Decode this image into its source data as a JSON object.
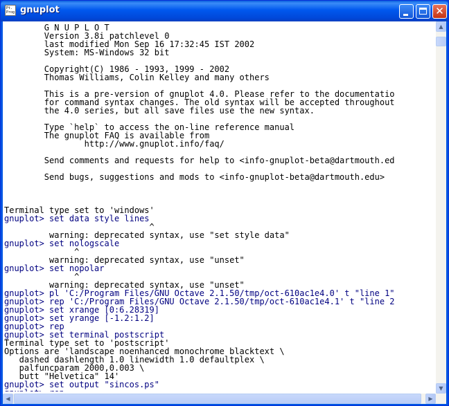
{
  "window": {
    "title": "gnuplot",
    "app_icon_text": "Pt. Prog",
    "minimize_icon": "minimize-icon",
    "maximize_icon": "maximize-icon",
    "close_icon": "close-icon"
  },
  "console": {
    "lines": [
      {
        "text": "        G N U P L O T",
        "type": "out"
      },
      {
        "text": "        Version 3.8i patchlevel 0",
        "type": "out"
      },
      {
        "text": "        last modified Mon Sep 16 17:32:45 IST 2002",
        "type": "out"
      },
      {
        "text": "        System: MS-Windows 32 bit",
        "type": "out"
      },
      {
        "text": "",
        "type": "out"
      },
      {
        "text": "        Copyright(C) 1986 - 1993, 1999 - 2002",
        "type": "out"
      },
      {
        "text": "        Thomas Williams, Colin Kelley and many others",
        "type": "out"
      },
      {
        "text": "",
        "type": "out"
      },
      {
        "text": "        This is a pre-version of gnuplot 4.0. Please refer to the documentatio",
        "type": "out"
      },
      {
        "text": "        for command syntax changes. The old syntax will be accepted throughout",
        "type": "out"
      },
      {
        "text": "        the 4.0 series, but all save files use the new syntax.",
        "type": "out"
      },
      {
        "text": "",
        "type": "out"
      },
      {
        "text": "        Type `help` to access the on-line reference manual",
        "type": "out"
      },
      {
        "text": "        The gnuplot FAQ is available from",
        "type": "out"
      },
      {
        "text": "                http://www.gnuplot.info/faq/",
        "type": "out"
      },
      {
        "text": "",
        "type": "out"
      },
      {
        "text": "        Send comments and requests for help to <info-gnuplot-beta@dartmouth.ed",
        "type": "out"
      },
      {
        "text": "",
        "type": "out"
      },
      {
        "text": "        Send bugs, suggestions and mods to <info-gnuplot-beta@dartmouth.edu>",
        "type": "out"
      },
      {
        "text": "",
        "type": "out"
      },
      {
        "text": "",
        "type": "out"
      },
      {
        "text": "",
        "type": "out"
      },
      {
        "text": "Terminal type set to 'windows'",
        "type": "out"
      },
      {
        "text": "gnuplot> set data style lines",
        "type": "cmd"
      },
      {
        "text": "                             ^",
        "type": "out"
      },
      {
        "text": "         warning: deprecated syntax, use \"set style data\"",
        "type": "out"
      },
      {
        "text": "gnuplot> set nologscale",
        "type": "cmd"
      },
      {
        "text": "              ^",
        "type": "out"
      },
      {
        "text": "         warning: deprecated syntax, use \"unset\"",
        "type": "out"
      },
      {
        "text": "gnuplot> set nopolar",
        "type": "cmd"
      },
      {
        "text": "              ^",
        "type": "out"
      },
      {
        "text": "         warning: deprecated syntax, use \"unset\"",
        "type": "out"
      },
      {
        "text": "gnuplot> pl 'C:/Program Files/GNU Octave 2.1.50/tmp/oct-610ac1e4.0' t \"line 1\"",
        "type": "cmd"
      },
      {
        "text": "gnuplot> rep 'C:/Program Files/GNU Octave 2.1.50/tmp/oct-610ac1e4.1' t \"line 2",
        "type": "cmd"
      },
      {
        "text": "gnuplot> set xrange [0:6.28319]",
        "type": "cmd"
      },
      {
        "text": "gnuplot> set yrange [-1.2:1.2]",
        "type": "cmd"
      },
      {
        "text": "gnuplot> rep",
        "type": "cmd"
      },
      {
        "text": "gnuplot> set terminal postscript",
        "type": "cmd"
      },
      {
        "text": "Terminal type set to 'postscript'",
        "type": "out"
      },
      {
        "text": "Options are 'landscape noenhanced monochrome blacktext \\",
        "type": "out"
      },
      {
        "text": "   dashed dashlength 1.0 linewidth 1.0 defaultplex \\",
        "type": "out"
      },
      {
        "text": "   palfuncparam 2000,0.003 \\",
        "type": "out"
      },
      {
        "text": "   butt \"Helvetica\" 14'",
        "type": "out"
      },
      {
        "text": "gnuplot> set output \"sincos.ps\"",
        "type": "cmd"
      },
      {
        "text": "gnuplot> rep",
        "type": "cmd"
      }
    ]
  },
  "scrollbars": {
    "up_arrow": "▲",
    "down_arrow": "▼",
    "left_arrow": "◀",
    "right_arrow": "▶"
  }
}
